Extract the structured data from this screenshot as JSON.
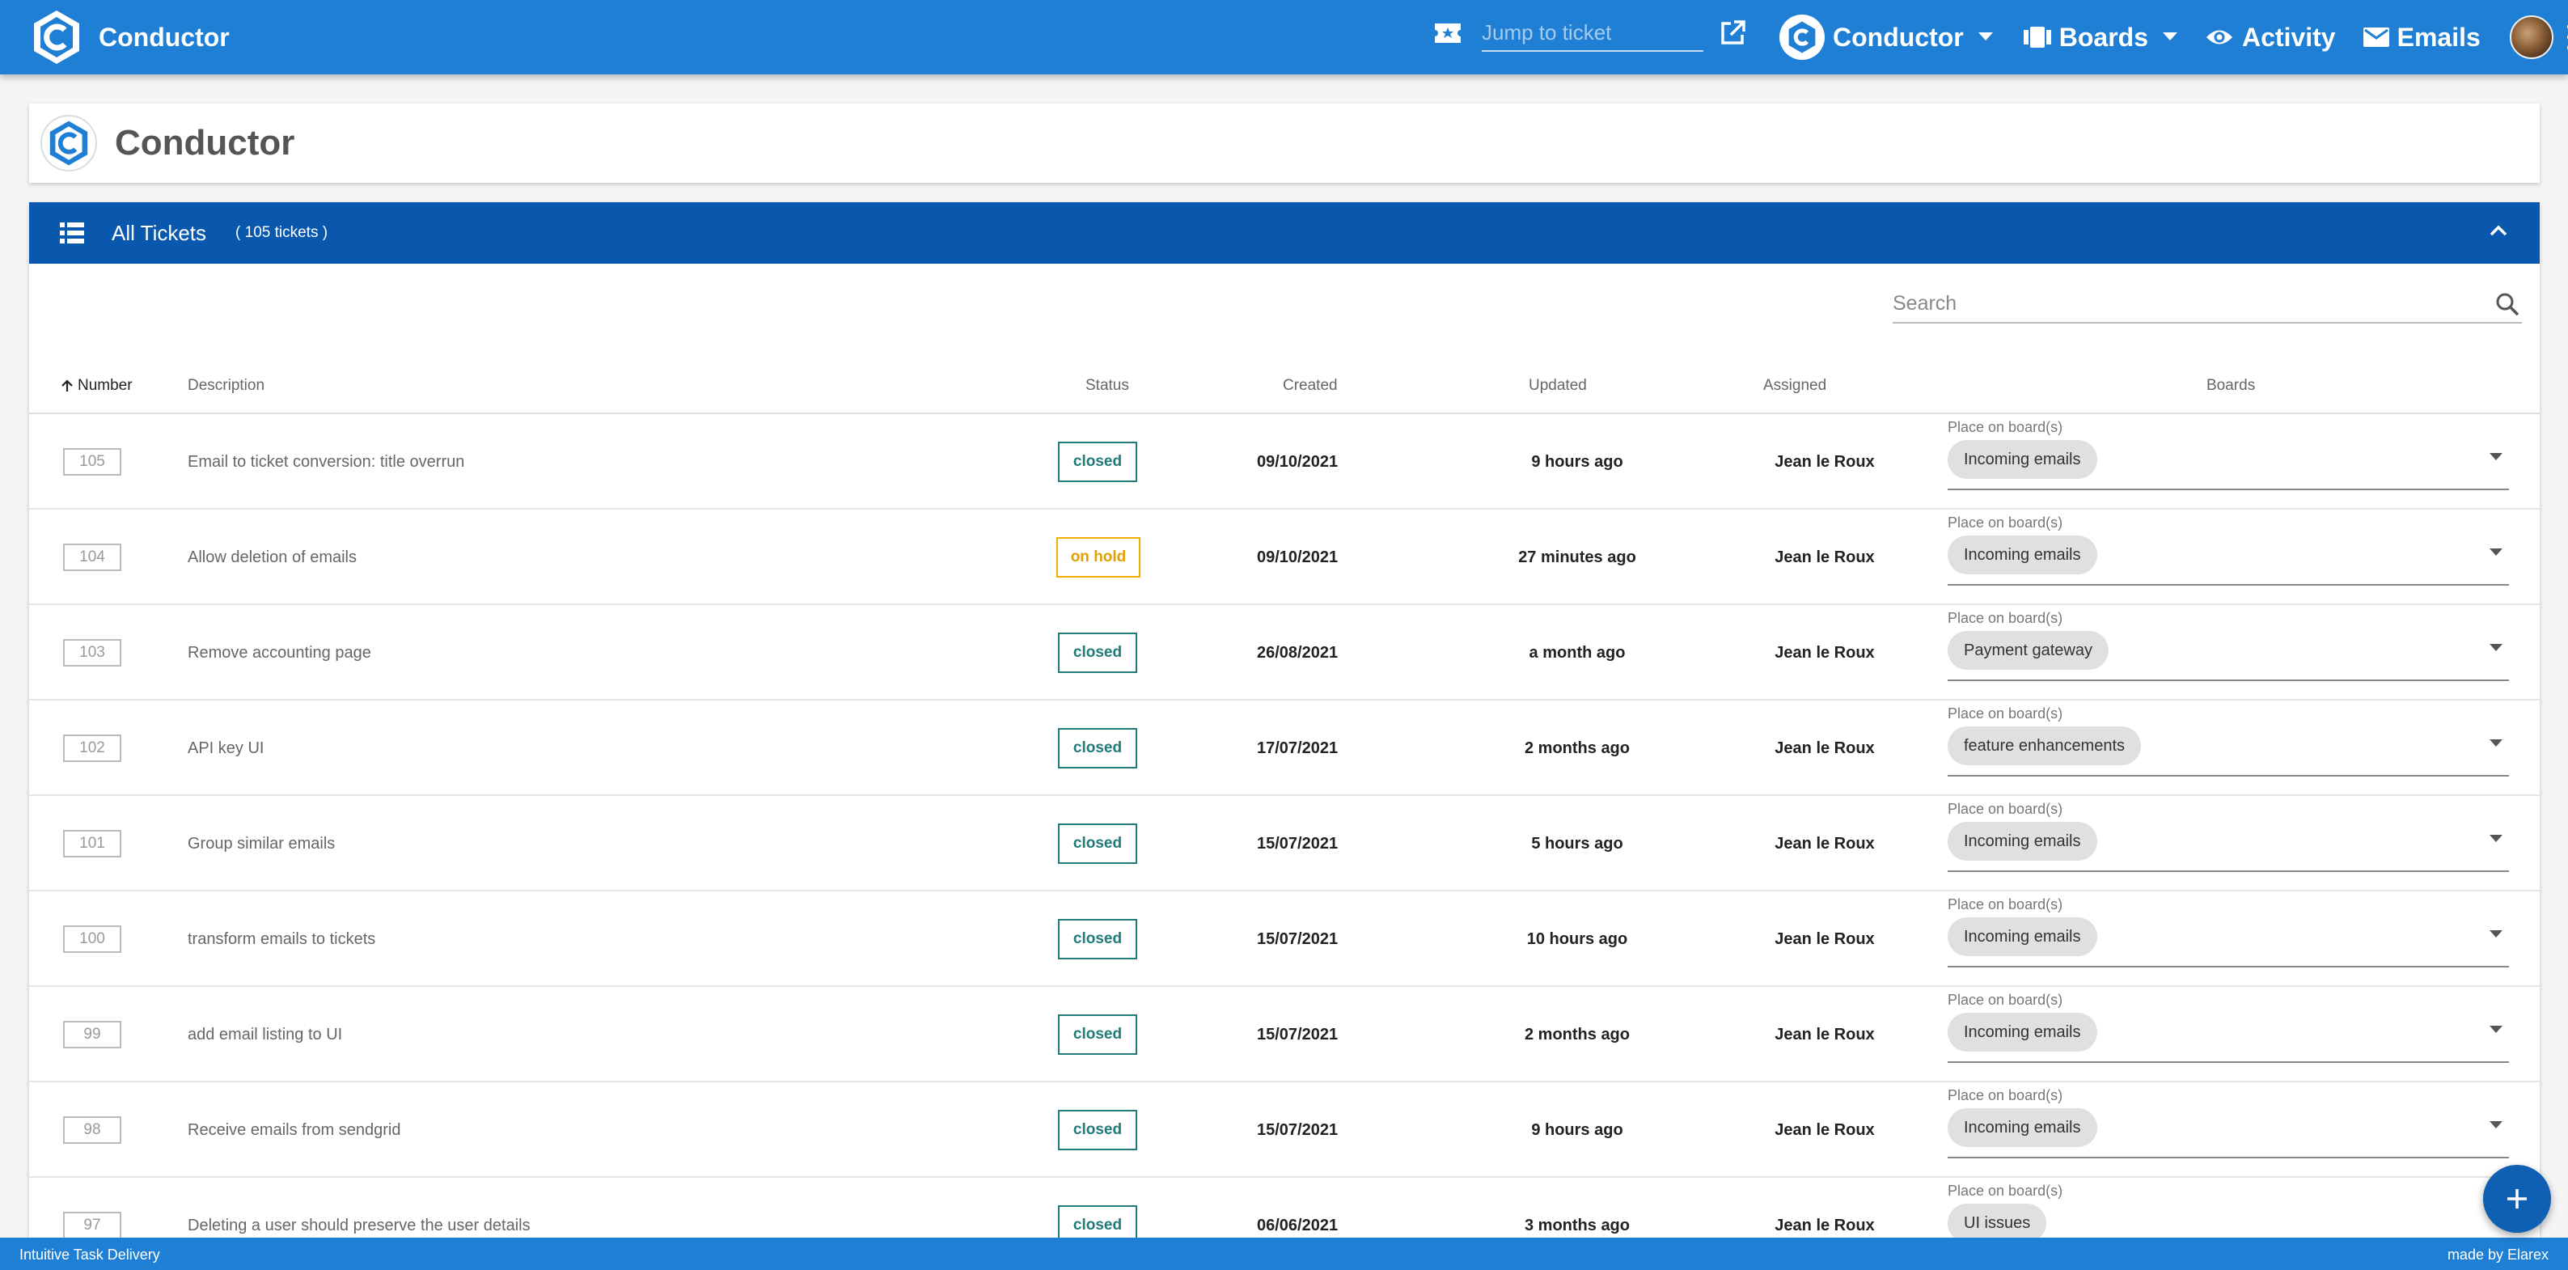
{
  "appbar": {
    "brand": "Conductor",
    "jump_placeholder": "Jump to ticket",
    "nav": {
      "workspace_label": "Conductor",
      "boards_label": "Boards",
      "activity_label": "Activity",
      "emails_label": "Emails"
    },
    "colors": {
      "bar": "#1e7fd5"
    }
  },
  "page": {
    "title": "Conductor"
  },
  "panel": {
    "title": "All Tickets",
    "count": "( 105 tickets )",
    "search_placeholder": "Search",
    "header_color": "#0a58ae"
  },
  "table": {
    "columns": {
      "number": "Number",
      "description": "Description",
      "status": "Status",
      "created": "Created",
      "updated": "Updated",
      "assigned": "Assigned",
      "boards": "Boards"
    },
    "sort": {
      "column": "Number",
      "direction": "ascending-arrow"
    },
    "boards_field_label": "Place on board(s)",
    "rows": [
      {
        "number": "105",
        "description": "Email to ticket conversion: title overrun",
        "status": "closed",
        "created": "09/10/2021",
        "updated": "9 hours ago",
        "assigned": "Jean le Roux",
        "board": "Incoming emails"
      },
      {
        "number": "104",
        "description": "Allow deletion of emails",
        "status": "on hold",
        "created": "09/10/2021",
        "updated": "27 minutes ago",
        "assigned": "Jean le Roux",
        "board": "Incoming emails"
      },
      {
        "number": "103",
        "description": "Remove accounting page",
        "status": "closed",
        "created": "26/08/2021",
        "updated": "a month ago",
        "assigned": "Jean le Roux",
        "board": "Payment gateway"
      },
      {
        "number": "102",
        "description": "API key UI",
        "status": "closed",
        "created": "17/07/2021",
        "updated": "2 months ago",
        "assigned": "Jean le Roux",
        "board": "feature enhancements"
      },
      {
        "number": "101",
        "description": "Group similar emails",
        "status": "closed",
        "created": "15/07/2021",
        "updated": "5 hours ago",
        "assigned": "Jean le Roux",
        "board": "Incoming emails"
      },
      {
        "number": "100",
        "description": "transform emails to tickets",
        "status": "closed",
        "created": "15/07/2021",
        "updated": "10 hours ago",
        "assigned": "Jean le Roux",
        "board": "Incoming emails"
      },
      {
        "number": "99",
        "description": "add email listing to UI",
        "status": "closed",
        "created": "15/07/2021",
        "updated": "2 months ago",
        "assigned": "Jean le Roux",
        "board": "Incoming emails"
      },
      {
        "number": "98",
        "description": "Receive emails from sendgrid",
        "status": "closed",
        "created": "15/07/2021",
        "updated": "9 hours ago",
        "assigned": "Jean le Roux",
        "board": "Incoming emails"
      },
      {
        "number": "97",
        "description": "Deleting a user should preserve the user details",
        "status": "closed",
        "created": "06/06/2021",
        "updated": "3 months ago",
        "assigned": "Jean le Roux",
        "board": "UI issues"
      }
    ],
    "status_colors": {
      "closed": "#1f7a78",
      "on hold": "#e0a000"
    }
  },
  "footer": {
    "left": "Intuitive Task Delivery",
    "right": "made by Elarex"
  }
}
